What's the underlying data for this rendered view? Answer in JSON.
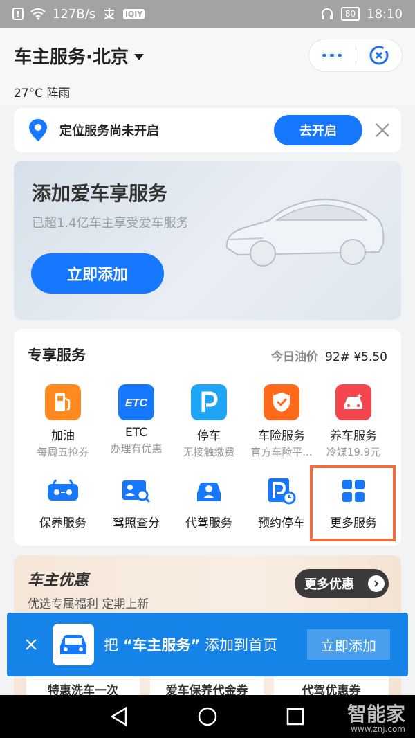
{
  "status_bar": {
    "speed": "127B/s",
    "battery": "80",
    "time": "18:10",
    "iqiyi": "iQIY"
  },
  "header": {
    "title": "车主服务·北京",
    "weather": "27°C 阵雨"
  },
  "location": {
    "text": "定位服务尚未开启",
    "button": "去开启"
  },
  "banner": {
    "title": "添加爱车享服务",
    "subtitle": "已超1.4亿车主享受爱车服务",
    "button": "立即添加"
  },
  "services": {
    "title": "专享服务",
    "oil_label": "今日油价",
    "oil_value": "92# ¥5.50",
    "row1": [
      {
        "name": "加油",
        "sub": "每周五抢券",
        "color": "#ff8a1f",
        "icon": "fuel-pump-icon"
      },
      {
        "name": "ETC",
        "sub": "办理有优惠",
        "color": "#1677ff",
        "icon": "etc-icon"
      },
      {
        "name": "停车",
        "sub": "无接触缴费",
        "color": "#1fa5f5",
        "icon": "parking-icon"
      },
      {
        "name": "车险服务",
        "sub": "官方车险平...",
        "color": "#ff6a1a",
        "icon": "shield-check-icon"
      },
      {
        "name": "养车服务",
        "sub": "冷媒19.9元",
        "color": "#f5454f",
        "icon": "car-wash-icon"
      }
    ],
    "row2": [
      {
        "name": "保养服务",
        "icon": "maintenance-icon"
      },
      {
        "name": "驾照查分",
        "icon": "license-search-icon"
      },
      {
        "name": "代驾服务",
        "icon": "designated-driver-icon"
      },
      {
        "name": "预约停车",
        "icon": "parking-reserve-icon"
      },
      {
        "name": "更多服务",
        "icon": "grid-icon"
      }
    ]
  },
  "deals": {
    "title": "车主优惠",
    "subtitle": "优选专属福利 定期上新",
    "button": "更多优惠",
    "coupons": [
      "特惠洗车一次",
      "爱车保养代金券",
      "代驾优惠券"
    ]
  },
  "toast": {
    "prefix": "把",
    "app": "“车主服务”",
    "suffix": "添加到首页",
    "button": "立即添加"
  },
  "watermark": {
    "brand": "智能家",
    "url": "www.znj.com"
  },
  "colors": {
    "accent": "#1677ff",
    "highlight": "#f26b3a",
    "toast": "#1683e8"
  }
}
